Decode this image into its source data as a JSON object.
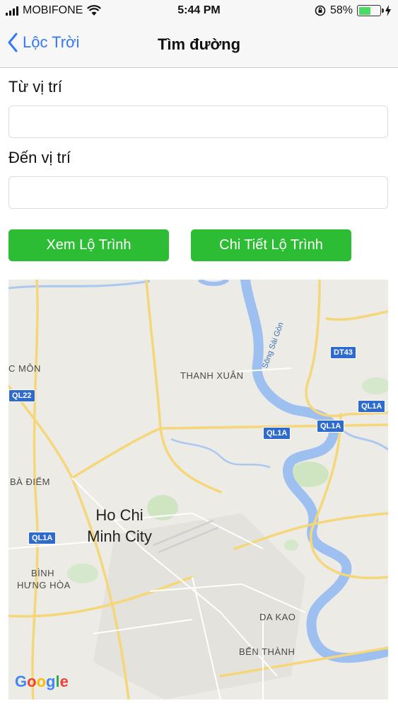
{
  "status_bar": {
    "carrier": "MOBIFONE",
    "time": "5:44 PM",
    "battery_percent": "58%",
    "battery_level": 0.58
  },
  "nav": {
    "back_label": "Lộc Trời",
    "title": "Tìm đường"
  },
  "form": {
    "from_label": "Từ vị trí",
    "from_value": "",
    "to_label": "Đến vị trí",
    "to_value": ""
  },
  "buttons": {
    "view_route": "Xem Lộ Trình",
    "route_details": "Chi Tiết Lộ Trình",
    "color": "#2dbd34"
  },
  "map": {
    "city_line1": "Ho Chi",
    "city_line2": "Minh City",
    "places": {
      "c_mon": "C MÔN",
      "thanh_xuan": "THANH XUÂN",
      "ba_diem": "BÀ ĐIỂM",
      "binh": "BÌNH",
      "hung_hoa": "HƯNG HÒA",
      "da_kao": "DA KAO",
      "ben_thanh": "BẾN THÀNH"
    },
    "river": "Sông Sài Gòn",
    "shields": {
      "ql22": "QL22",
      "ql1a_a": "QL1A",
      "ql1a_b": "QL1A",
      "ql1a_c": "QL1A",
      "ql1a_d": "QL1A",
      "dt43": "DT43"
    },
    "logo": "Google"
  }
}
